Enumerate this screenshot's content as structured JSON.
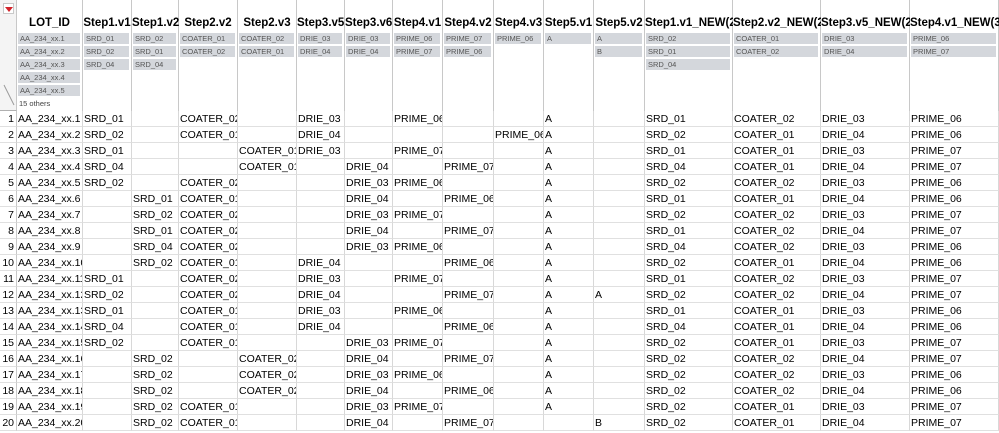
{
  "table": {
    "columns": [
      {
        "name": "LOT_ID",
        "summary": [
          "AA_234_xx.1",
          "AA_234_xx.2",
          "AA_234_xx.3",
          "AA_234_xx.4",
          "AA_234_xx.5"
        ],
        "more": "15 others"
      },
      {
        "name": "Step1.v1",
        "summary": [
          "SRD_01",
          "SRD_02",
          "SRD_04"
        ]
      },
      {
        "name": "Step1.v2",
        "summary": [
          "SRD_02",
          "SRD_01",
          "SRD_04"
        ]
      },
      {
        "name": "Step2.v2",
        "summary": [
          "COATER_01",
          "COATER_02"
        ]
      },
      {
        "name": "Step2.v3",
        "summary": [
          "COATER_02",
          "COATER_01"
        ]
      },
      {
        "name": "Step3.v5",
        "summary": [
          "DRIE_03",
          "DRIE_04"
        ]
      },
      {
        "name": "Step3.v6",
        "summary": [
          "DRIE_03",
          "DRIE_04"
        ]
      },
      {
        "name": "Step4.v1",
        "summary": [
          "PRIME_06",
          "PRIME_07"
        ]
      },
      {
        "name": "Step4.v2",
        "summary": [
          "PRIME_07",
          "PRIME_06"
        ]
      },
      {
        "name": "Step4.v3",
        "summary": [
          "PRIME_06"
        ]
      },
      {
        "name": "Step5.v1",
        "summary": [
          "A"
        ]
      },
      {
        "name": "Step5.v2",
        "summary": [
          "A",
          "B"
        ]
      },
      {
        "name": "Step1.v1_NEW(2)",
        "summary": [
          "SRD_02",
          "SRD_01",
          "SRD_04"
        ]
      },
      {
        "name": "Step2.v2_NEW(2)",
        "summary": [
          "COATER_01",
          "COATER_02"
        ]
      },
      {
        "name": "Step3.v5_NEW(2)",
        "summary": [
          "DRIE_03",
          "DRIE_04"
        ]
      },
      {
        "name": "Step4.v1_NEW(3)",
        "summary": [
          "PRIME_06",
          "PRIME_07"
        ]
      }
    ],
    "rows": [
      [
        "AA_234_xx.1",
        "SRD_01",
        "",
        "COATER_02",
        "",
        "DRIE_03",
        "",
        "PRIME_06",
        "",
        "",
        "A",
        "",
        "SRD_01",
        "COATER_02",
        "DRIE_03",
        "PRIME_06"
      ],
      [
        "AA_234_xx.2",
        "SRD_02",
        "",
        "COATER_01",
        "",
        "DRIE_04",
        "",
        "",
        "",
        "PRIME_06",
        "A",
        "",
        "SRD_02",
        "COATER_01",
        "DRIE_04",
        "PRIME_06"
      ],
      [
        "AA_234_xx.3",
        "SRD_01",
        "",
        "",
        "COATER_01",
        "DRIE_03",
        "",
        "PRIME_07",
        "",
        "",
        "A",
        "",
        "SRD_01",
        "COATER_01",
        "DRIE_03",
        "PRIME_07"
      ],
      [
        "AA_234_xx.4",
        "SRD_04",
        "",
        "",
        "COATER_01",
        "",
        "DRIE_04",
        "",
        "PRIME_07",
        "",
        "A",
        "",
        "SRD_04",
        "COATER_01",
        "DRIE_04",
        "PRIME_07"
      ],
      [
        "AA_234_xx.5",
        "SRD_02",
        "",
        "COATER_02",
        "",
        "",
        "DRIE_03",
        "PRIME_06",
        "",
        "",
        "A",
        "",
        "SRD_02",
        "COATER_02",
        "DRIE_03",
        "PRIME_06"
      ],
      [
        "AA_234_xx.6",
        "",
        "SRD_01",
        "COATER_01",
        "",
        "",
        "DRIE_04",
        "",
        "PRIME_06",
        "",
        "A",
        "",
        "SRD_01",
        "COATER_01",
        "DRIE_04",
        "PRIME_06"
      ],
      [
        "AA_234_xx.7",
        "",
        "SRD_02",
        "COATER_02",
        "",
        "",
        "DRIE_03",
        "PRIME_07",
        "",
        "",
        "A",
        "",
        "SRD_02",
        "COATER_02",
        "DRIE_03",
        "PRIME_07"
      ],
      [
        "AA_234_xx.8",
        "",
        "SRD_01",
        "COATER_02",
        "",
        "",
        "DRIE_04",
        "",
        "PRIME_07",
        "",
        "A",
        "",
        "SRD_01",
        "COATER_02",
        "DRIE_04",
        "PRIME_07"
      ],
      [
        "AA_234_xx.9",
        "",
        "SRD_04",
        "COATER_02",
        "",
        "",
        "DRIE_03",
        "PRIME_06",
        "",
        "",
        "A",
        "",
        "SRD_04",
        "COATER_02",
        "DRIE_03",
        "PRIME_06"
      ],
      [
        "AA_234_xx.10",
        "",
        "SRD_02",
        "COATER_01",
        "",
        "DRIE_04",
        "",
        "",
        "PRIME_06",
        "",
        "A",
        "",
        "SRD_02",
        "COATER_01",
        "DRIE_04",
        "PRIME_06"
      ],
      [
        "AA_234_xx.11",
        "SRD_01",
        "",
        "COATER_02",
        "",
        "DRIE_03",
        "",
        "PRIME_07",
        "",
        "",
        "A",
        "",
        "SRD_01",
        "COATER_02",
        "DRIE_03",
        "PRIME_07"
      ],
      [
        "AA_234_xx.12",
        "SRD_02",
        "",
        "COATER_02",
        "",
        "DRIE_04",
        "",
        "",
        "PRIME_07",
        "",
        "A",
        "A",
        "SRD_02",
        "COATER_02",
        "DRIE_04",
        "PRIME_07"
      ],
      [
        "AA_234_xx.13",
        "SRD_01",
        "",
        "COATER_01",
        "",
        "DRIE_03",
        "",
        "PRIME_06",
        "",
        "",
        "A",
        "",
        "SRD_01",
        "COATER_01",
        "DRIE_03",
        "PRIME_06"
      ],
      [
        "AA_234_xx.14",
        "SRD_04",
        "",
        "COATER_01",
        "",
        "DRIE_04",
        "",
        "",
        "PRIME_06",
        "",
        "A",
        "",
        "SRD_04",
        "COATER_01",
        "DRIE_04",
        "PRIME_06"
      ],
      [
        "AA_234_xx.15",
        "SRD_02",
        "",
        "COATER_01",
        "",
        "",
        "DRIE_03",
        "PRIME_07",
        "",
        "",
        "A",
        "",
        "SRD_02",
        "COATER_01",
        "DRIE_03",
        "PRIME_07"
      ],
      [
        "AA_234_xx.16",
        "",
        "SRD_02",
        "",
        "COATER_02",
        "",
        "DRIE_04",
        "",
        "PRIME_07",
        "",
        "A",
        "",
        "SRD_02",
        "COATER_02",
        "DRIE_04",
        "PRIME_07"
      ],
      [
        "AA_234_xx.17",
        "",
        "SRD_02",
        "",
        "COATER_02",
        "",
        "DRIE_03",
        "PRIME_06",
        "",
        "",
        "A",
        "",
        "SRD_02",
        "COATER_02",
        "DRIE_03",
        "PRIME_06"
      ],
      [
        "AA_234_xx.18",
        "",
        "SRD_02",
        "",
        "COATER_02",
        "",
        "DRIE_04",
        "",
        "PRIME_06",
        "",
        "A",
        "",
        "SRD_02",
        "COATER_02",
        "DRIE_04",
        "PRIME_06"
      ],
      [
        "AA_234_xx.19",
        "",
        "SRD_02",
        "COATER_01",
        "",
        "",
        "DRIE_03",
        "PRIME_07",
        "",
        "",
        "A",
        "",
        "SRD_02",
        "COATER_01",
        "DRIE_03",
        "PRIME_07"
      ],
      [
        "AA_234_xx.20",
        "",
        "SRD_02",
        "COATER_01",
        "",
        "",
        "DRIE_04",
        "",
        "PRIME_07",
        "",
        "",
        "B",
        "SRD_02",
        "COATER_01",
        "DRIE_04",
        "PRIME_07"
      ]
    ]
  },
  "icons": {
    "corner_menu": "red-triangle-menu-icon",
    "corner_select": "select-all-diagonal-icon"
  },
  "colors": {
    "chip_bg": "#d4d7dc",
    "menu_triangle": "#d2232a",
    "grid_line": "#c8c8c8"
  }
}
